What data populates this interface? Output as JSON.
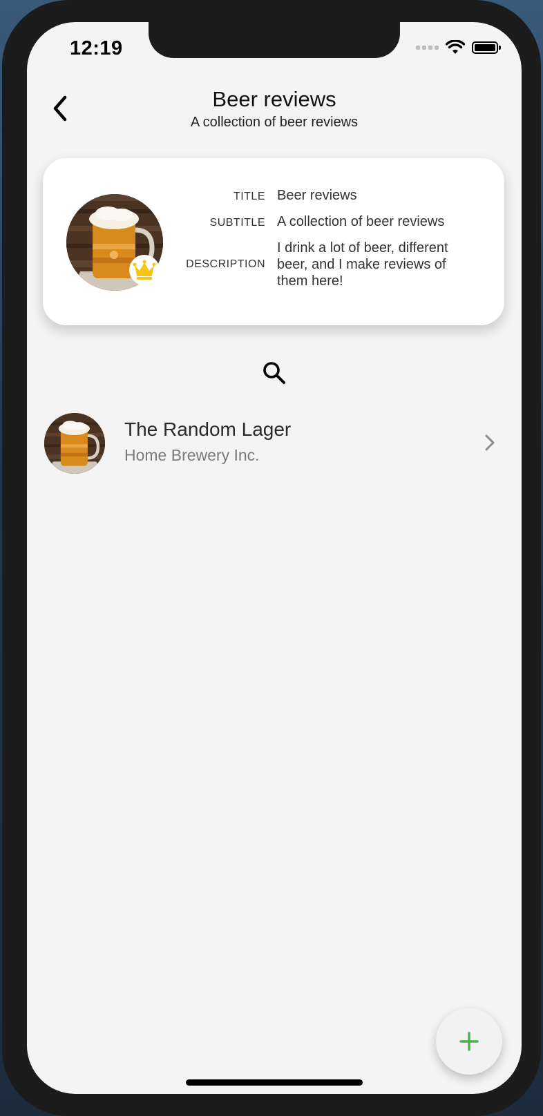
{
  "status_bar": {
    "time": "12:19"
  },
  "header": {
    "title": "Beer reviews",
    "subtitle": "A collection of beer reviews"
  },
  "info_card": {
    "fields": [
      {
        "label": "TITLE",
        "value": "Beer reviews"
      },
      {
        "label": "SUBTITLE",
        "value": "A collection of beer reviews"
      },
      {
        "label": "DESCRIPTION",
        "value": "I drink a lot of beer, different beer, and I make reviews of them here!"
      }
    ]
  },
  "reviews": [
    {
      "title": "The Random Lager",
      "subtitle": "Home Brewery Inc."
    }
  ],
  "colors": {
    "accent_green": "#4caf50",
    "crown_gold": "#f5c518",
    "screen_background": "#f4f4f4"
  },
  "icons": {
    "back": "chevron-left-icon",
    "search": "search-icon",
    "item_chevron": "chevron-right-icon",
    "fab": "plus-icon",
    "badge": "crown-icon"
  }
}
